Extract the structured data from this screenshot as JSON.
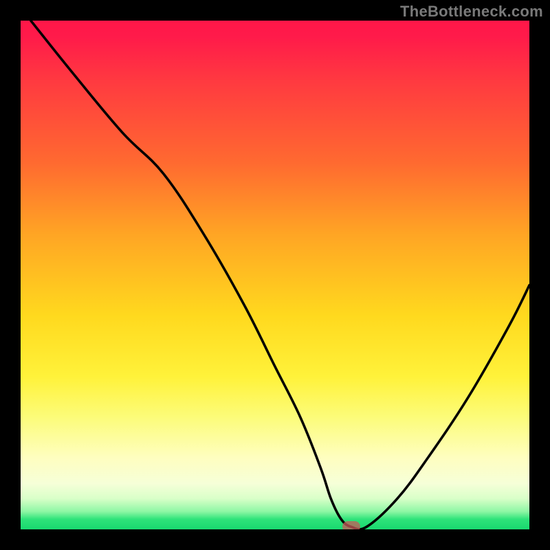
{
  "watermark": "TheBottleneck.com",
  "chart_data": {
    "type": "line",
    "title": "",
    "xlabel": "",
    "ylabel": "",
    "xlim": [
      0,
      100
    ],
    "ylim": [
      0,
      100
    ],
    "grid": false,
    "legend": false,
    "series": [
      {
        "name": "bottleneck-curve",
        "x": [
          2,
          10,
          20,
          28,
          36,
          44,
          50,
          55,
          59,
          61,
          63,
          65,
          68,
          74,
          80,
          88,
          96,
          100
        ],
        "y": [
          100,
          90,
          78,
          70,
          58,
          44,
          32,
          22,
          12,
          6,
          2,
          0.5,
          0.5,
          6,
          14,
          26,
          40,
          48
        ]
      }
    ],
    "marker": {
      "x": 65,
      "y": 0.6
    },
    "background_gradient": {
      "stops": [
        {
          "pos": 0.0,
          "color": "#ff1748"
        },
        {
          "pos": 0.28,
          "color": "#ff6a30"
        },
        {
          "pos": 0.58,
          "color": "#ffd91e"
        },
        {
          "pos": 0.86,
          "color": "#fefec0"
        },
        {
          "pos": 0.98,
          "color": "#2fe37a"
        },
        {
          "pos": 1.0,
          "color": "#19d86f"
        }
      ]
    }
  }
}
